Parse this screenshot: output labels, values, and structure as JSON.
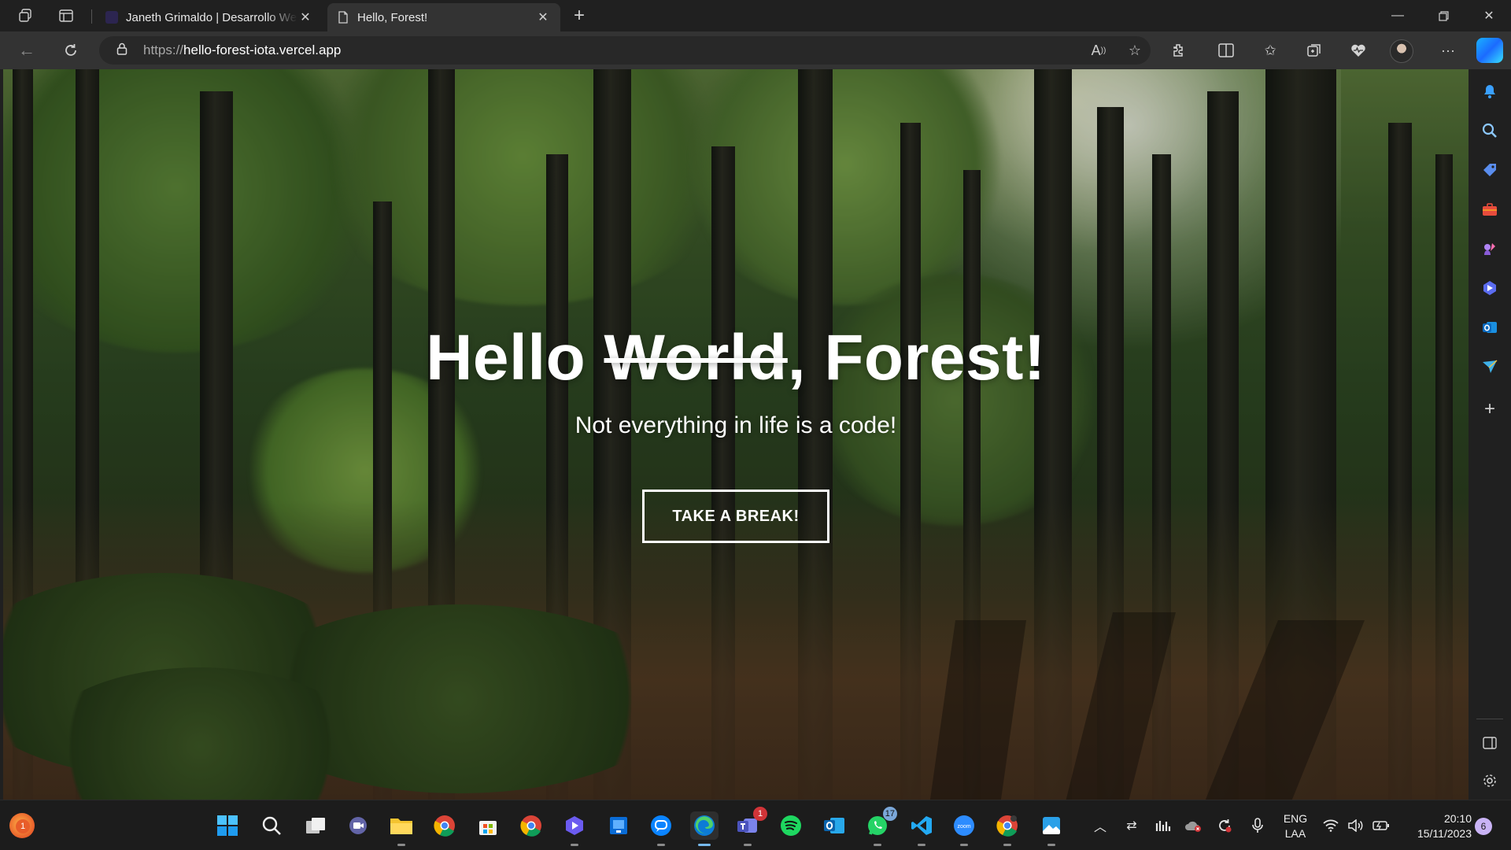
{
  "browser": {
    "tabs": [
      {
        "label": "Janeth Grimaldo | Desarrollo Web",
        "active": false
      },
      {
        "label": "Hello, Forest!",
        "active": true
      }
    ],
    "address": {
      "scheme": "https://",
      "host": "hello-forest-iota.vercel.app"
    },
    "accent_color": "#1b6bff"
  },
  "page": {
    "title_prefix": "Hello ",
    "title_struck": "World",
    "title_suffix": ", Forest!",
    "subtitle": "Not everything in life is a code!",
    "button_label": "TAKE A BREAK!"
  },
  "taskbar": {
    "weather_badge": "1",
    "teams_badge": "1",
    "whatsapp_badge": "17",
    "language": "ENG",
    "keyboard": "LAA",
    "time": "20:10",
    "date": "15/11/2023",
    "notifications": "6"
  }
}
